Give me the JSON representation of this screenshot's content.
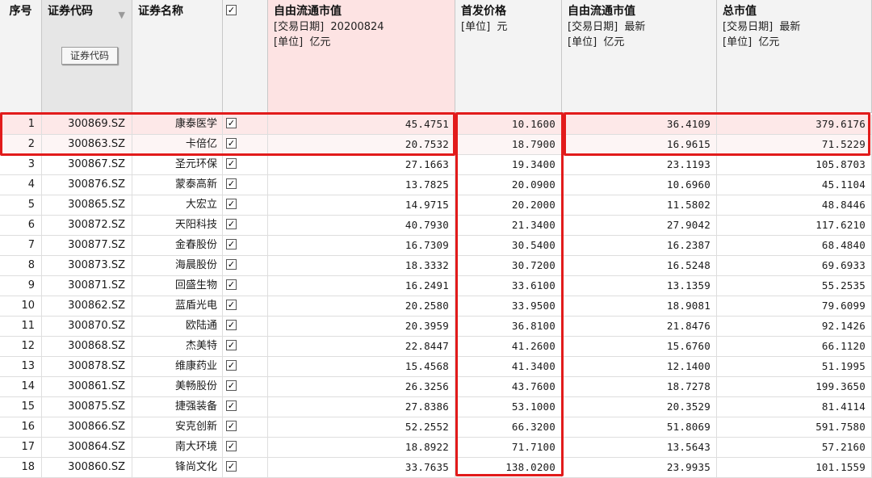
{
  "colors": {
    "highlight": "#e21b1b",
    "pink_header": "#fde3e3"
  },
  "headers": {
    "seq": "序号",
    "code": "证券代码",
    "code_button": "证券代码",
    "name": "证券名称",
    "check": "✓",
    "ffmc_date": {
      "title": "自由流通市值",
      "line1": "[交易日期]  20200824",
      "line2": "[单位]  亿元"
    },
    "ipo_price": {
      "title": "首发价格",
      "line1": "[单位]  元"
    },
    "ffmc_latest": {
      "title": "自由流通市值",
      "line1": "[交易日期]  最新",
      "line2": "[单位]  亿元"
    },
    "total_mc": {
      "title": "总市值",
      "line1": "[交易日期]  最新",
      "line2": "[单位]  亿元"
    }
  },
  "rows": [
    {
      "seq": "1",
      "code": "300869.SZ",
      "name": "康泰医学",
      "check": "✓",
      "ffmc": "45.4751",
      "ipo": "10.1600",
      "ffmc_latest": "36.4109",
      "total": "379.6176"
    },
    {
      "seq": "2",
      "code": "300863.SZ",
      "name": "卡倍亿",
      "check": "✓",
      "ffmc": "20.7532",
      "ipo": "18.7900",
      "ffmc_latest": "16.9615",
      "total": "71.5229"
    },
    {
      "seq": "3",
      "code": "300867.SZ",
      "name": "圣元环保",
      "check": "✓",
      "ffmc": "27.1663",
      "ipo": "19.3400",
      "ffmc_latest": "23.1193",
      "total": "105.8703"
    },
    {
      "seq": "4",
      "code": "300876.SZ",
      "name": "蒙泰高新",
      "check": "✓",
      "ffmc": "13.7825",
      "ipo": "20.0900",
      "ffmc_latest": "10.6960",
      "total": "45.1104"
    },
    {
      "seq": "5",
      "code": "300865.SZ",
      "name": "大宏立",
      "check": "✓",
      "ffmc": "14.9715",
      "ipo": "20.2000",
      "ffmc_latest": "11.5802",
      "total": "48.8446"
    },
    {
      "seq": "6",
      "code": "300872.SZ",
      "name": "天阳科技",
      "check": "✓",
      "ffmc": "40.7930",
      "ipo": "21.3400",
      "ffmc_latest": "27.9042",
      "total": "117.6210"
    },
    {
      "seq": "7",
      "code": "300877.SZ",
      "name": "金春股份",
      "check": "✓",
      "ffmc": "16.7309",
      "ipo": "30.5400",
      "ffmc_latest": "16.2387",
      "total": "68.4840"
    },
    {
      "seq": "8",
      "code": "300873.SZ",
      "name": "海晨股份",
      "check": "✓",
      "ffmc": "18.3332",
      "ipo": "30.7200",
      "ffmc_latest": "16.5248",
      "total": "69.6933"
    },
    {
      "seq": "9",
      "code": "300871.SZ",
      "name": "回盛生物",
      "check": "✓",
      "ffmc": "16.2491",
      "ipo": "33.6100",
      "ffmc_latest": "13.1359",
      "total": "55.2535"
    },
    {
      "seq": "10",
      "code": "300862.SZ",
      "name": "蓝盾光电",
      "check": "✓",
      "ffmc": "20.2580",
      "ipo": "33.9500",
      "ffmc_latest": "18.9081",
      "total": "79.6099"
    },
    {
      "seq": "11",
      "code": "300870.SZ",
      "name": "欧陆通",
      "check": "✓",
      "ffmc": "20.3959",
      "ipo": "36.8100",
      "ffmc_latest": "21.8476",
      "total": "92.1426"
    },
    {
      "seq": "12",
      "code": "300868.SZ",
      "name": "杰美特",
      "check": "✓",
      "ffmc": "22.8447",
      "ipo": "41.2600",
      "ffmc_latest": "15.6760",
      "total": "66.1120"
    },
    {
      "seq": "13",
      "code": "300878.SZ",
      "name": "维康药业",
      "check": "✓",
      "ffmc": "15.4568",
      "ipo": "41.3400",
      "ffmc_latest": "12.1400",
      "total": "51.1995"
    },
    {
      "seq": "14",
      "code": "300861.SZ",
      "name": "美畅股份",
      "check": "✓",
      "ffmc": "26.3256",
      "ipo": "43.7600",
      "ffmc_latest": "18.7278",
      "total": "199.3650"
    },
    {
      "seq": "15",
      "code": "300875.SZ",
      "name": "捷强装备",
      "check": "✓",
      "ffmc": "27.8386",
      "ipo": "53.1000",
      "ffmc_latest": "20.3529",
      "total": "81.4114"
    },
    {
      "seq": "16",
      "code": "300866.SZ",
      "name": "安克创新",
      "check": "✓",
      "ffmc": "52.2552",
      "ipo": "66.3200",
      "ffmc_latest": "51.8069",
      "total": "591.7580"
    },
    {
      "seq": "17",
      "code": "300864.SZ",
      "name": "南大环境",
      "check": "✓",
      "ffmc": "18.8922",
      "ipo": "71.7100",
      "ffmc_latest": "13.5643",
      "total": "57.2160"
    },
    {
      "seq": "18",
      "code": "300860.SZ",
      "name": "锋尚文化",
      "check": "✓",
      "ffmc": "33.7635",
      "ipo": "138.0200",
      "ffmc_latest": "23.9935",
      "total": "101.1559"
    }
  ]
}
